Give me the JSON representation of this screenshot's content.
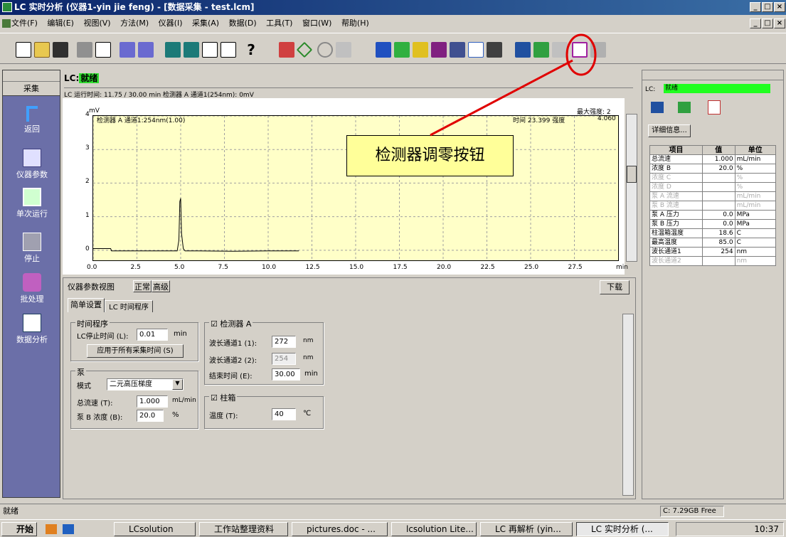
{
  "window": {
    "title": "LC 实时分析 (仪器1-yin jie feng) - [数据采集 - test.lcm]"
  },
  "menu": [
    "文件(F)",
    "编辑(E)",
    "视图(V)",
    "方法(M)",
    "仪器(I)",
    "采集(A)",
    "数据(D)",
    "工具(T)",
    "窗口(W)",
    "帮助(H)"
  ],
  "sidebar": {
    "tab": "采集",
    "items": [
      {
        "label": "返回",
        "icon": "back-arrow-icon"
      },
      {
        "label": "仪器参数",
        "icon": "instrument-params-icon"
      },
      {
        "label": "单次运行",
        "icon": "single-run-icon"
      },
      {
        "label": "停止",
        "icon": "stop-icon"
      },
      {
        "label": "批处理",
        "icon": "batch-icon"
      },
      {
        "label": "数据分析",
        "icon": "data-analysis-icon"
      }
    ]
  },
  "status": {
    "label": "LC:",
    "value": "就绪",
    "runtime": "LC 运行时间: 11.75 / 30.00 min 检测器 A 通道1(254nm): 0mV"
  },
  "callout": {
    "text": "检测器调零按钮"
  },
  "chart_data": {
    "type": "line",
    "title": "",
    "series": [
      {
        "name": "检测器 A 通道1:254nm(1.00)",
        "x": [
          0.0,
          1.0,
          1.05,
          4.8,
          4.9,
          4.95,
          5.0,
          5.05,
          5.15,
          5.25,
          6.0,
          8.0,
          10.0,
          11.75
        ],
        "y": [
          0.05,
          0.05,
          -0.02,
          -0.02,
          0.3,
          1.45,
          1.55,
          0.5,
          0.05,
          -0.02,
          -0.02,
          -0.03,
          -0.02,
          -0.02
        ]
      }
    ],
    "xlabel": "min",
    "ylabel": "mV",
    "xlim": [
      0,
      30
    ],
    "ylim": [
      -0.3,
      4
    ],
    "xticks": [
      "0.0",
      "2.5",
      "5.0",
      "7.5",
      "10.0",
      "12.5",
      "15.0",
      "17.5",
      "20.0",
      "22.5",
      "25.0",
      "27.5"
    ],
    "yticks": [
      "0",
      "1",
      "2",
      "3",
      "4"
    ],
    "annotations": {
      "time_label": "时间",
      "time_value": "23.399",
      "intensity_label": "强度",
      "intensity_value": "4.060",
      "max_label": "最大强度:",
      "max_value": "2"
    },
    "grid": true
  },
  "params_panel": {
    "view_label": "仪器参数视图",
    "mode_normal": "正常",
    "mode_advanced": "高级",
    "download": "下载",
    "tab1": "简单设置",
    "tab2": "LC 时间程序",
    "time_program": "时间程序",
    "stop_time_label": "LC停止时间 (L):",
    "stop_time_value": "0.01",
    "min": "min",
    "apply_all": "应用于所有采集时间 (S)",
    "pump_group": "泵",
    "mode_label": "模式",
    "mode_value": "二元高压梯度",
    "flow_label": "总流速 (T):",
    "flow_value": "1.000",
    "flow_unit": "mL/min",
    "conc_label": "泵 B 浓度 (B):",
    "conc_value": "20.0",
    "pct": "%",
    "detector_group": "检测器 A",
    "wl1_label": "波长通道1 (1):",
    "wl1_value": "272",
    "wl2_label": "波长通道2 (2):",
    "wl2_value": "254",
    "nm": "nm",
    "end_label": "结束时间 (E):",
    "end_value": "30.00",
    "oven_group": "柱箱",
    "temp_label": "温度 (T):",
    "temp_value": "40",
    "temp_unit": "℃"
  },
  "right_panel": {
    "lc_label": "LC:",
    "lc_status": "就绪",
    "detail_button": "详细信息...",
    "headers": [
      "项目",
      "值",
      "单位"
    ],
    "rows": [
      [
        "总流速",
        "1.000",
        "mL/min",
        ""
      ],
      [
        "浓度 B",
        "20.0",
        "%",
        ""
      ],
      [
        "浓度 C",
        "",
        "%",
        "dim"
      ],
      [
        "浓度 D",
        "",
        "%",
        "dim"
      ],
      [
        "泵 A 流速",
        "",
        "mL/min",
        "dim"
      ],
      [
        "泵 B 流速",
        "",
        "mL/min",
        "dim"
      ],
      [
        "泵 A 压力",
        "0.0",
        "MPa",
        ""
      ],
      [
        "泵 B 压力",
        "0.0",
        "MPa",
        ""
      ],
      [
        "柱温箱温度",
        "18.6",
        "C",
        ""
      ],
      [
        "最高温度",
        "85.0",
        "C",
        ""
      ],
      [
        "波长通道1",
        "254",
        "nm",
        ""
      ],
      [
        "波长通道2",
        "",
        "nm",
        "dim"
      ]
    ]
  },
  "statusbar": {
    "text": "就绪",
    "disk": "C: 7.29GB Free"
  },
  "taskbar": {
    "start": "开始",
    "items": [
      "LCsolution",
      "工作站整理资料",
      "pictures.doc - ...",
      "lcsolution Lite...",
      "LC 再解析 (yin...",
      "LC 实时分析 (..."
    ],
    "clock": "10:37"
  }
}
